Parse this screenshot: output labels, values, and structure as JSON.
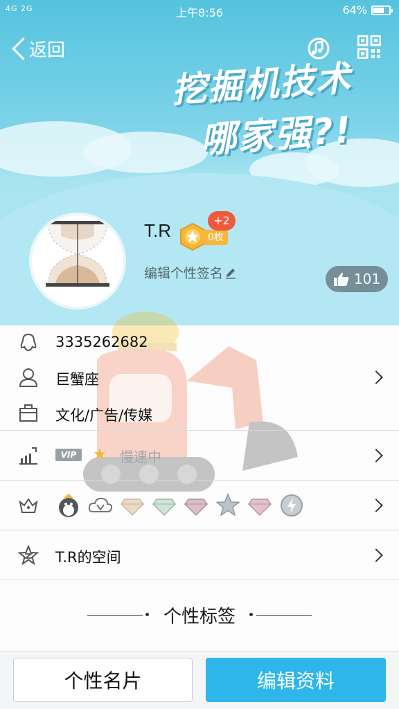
{
  "status_bar": {
    "signal": "4G 2G",
    "time": "上午8:56",
    "battery": "64%",
    "battery_level": 0.64
  },
  "nav": {
    "back_label": "返回"
  },
  "banner": {
    "line1": "挖掘机技术",
    "line2": "哪家强?!"
  },
  "profile": {
    "nickname": "T.R",
    "plus_badge": "+2",
    "coin_tag": "0枚",
    "signature": "编辑个性签名",
    "likes": "101"
  },
  "info": {
    "qq_number": "3335262682",
    "constellation": "巨蟹座",
    "profession": "文化/广告/传媒",
    "vip_tag": "VIP",
    "vip_speed": "慢速中",
    "space": "T.R的空间"
  },
  "tags": {
    "title": "个性标签"
  },
  "buttons": {
    "card": "个性名片",
    "edit": "编辑资料"
  },
  "colors": {
    "accent": "#2eb6ea",
    "banner": "#55c3de",
    "badge_red": "#f05a3c",
    "coin": "#f6b73c"
  }
}
